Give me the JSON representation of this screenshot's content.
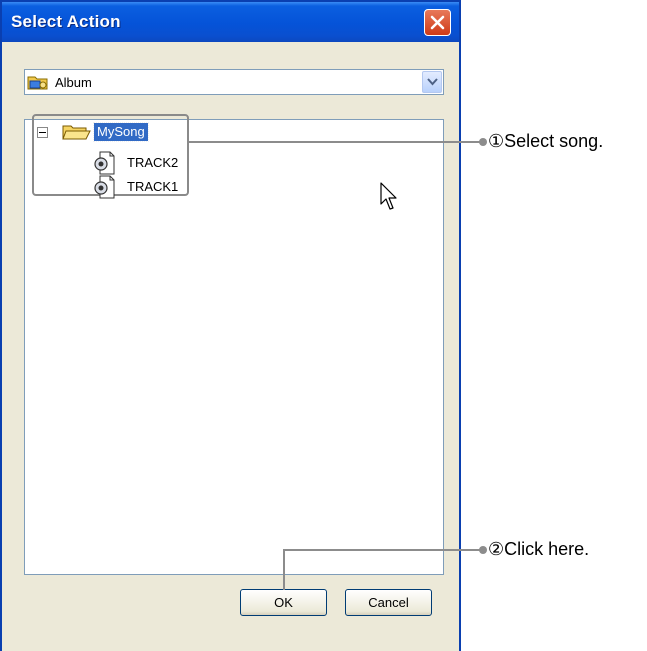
{
  "dialog": {
    "title": "Select Action",
    "close_icon": "close-icon"
  },
  "combo": {
    "selected": "Album",
    "icon": "album-folder-icon",
    "dropdown_icon": "chevron-down-icon"
  },
  "tree": {
    "root": {
      "label": "MySong",
      "expanded": true,
      "selected": true,
      "icon": "folder-icon"
    },
    "children": [
      {
        "label": "TRACK2",
        "icon": "audio-file-icon"
      },
      {
        "label": "TRACK1",
        "icon": "audio-file-icon"
      }
    ]
  },
  "buttons": {
    "ok": "OK",
    "cancel": "Cancel"
  },
  "callouts": [
    {
      "text": "①Select song."
    },
    {
      "text": "②Click here."
    }
  ],
  "colors": {
    "titlebar": "#0553d8",
    "selection": "#316ac5",
    "window_bg": "#ece9d8",
    "close_button": "#cf3a17"
  }
}
